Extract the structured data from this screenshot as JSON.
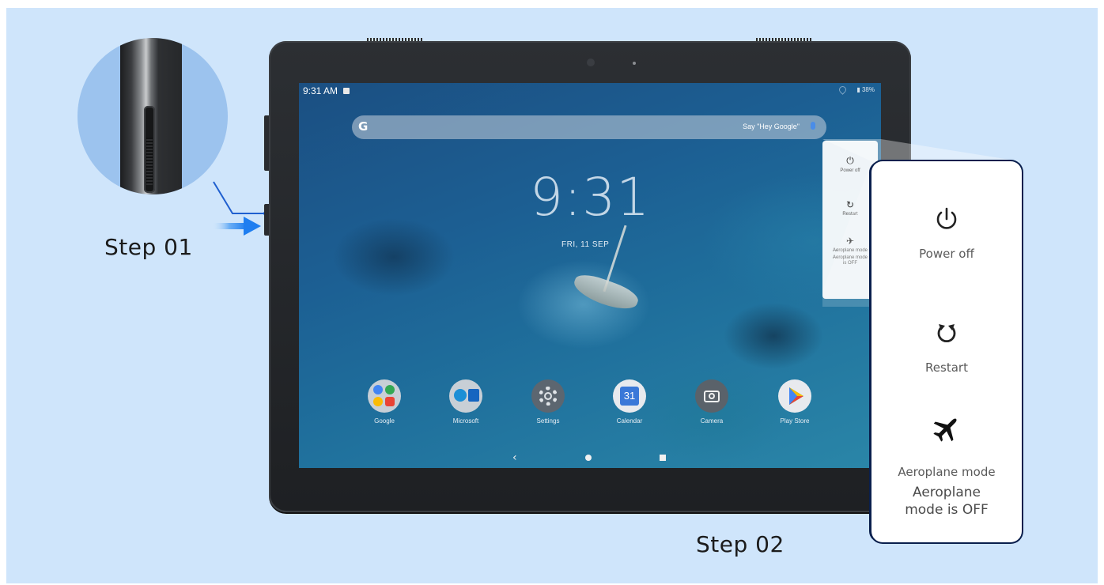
{
  "steps": {
    "step1": "Step 01",
    "step2": "Step 02"
  },
  "status_bar": {
    "time": "9:31 AM",
    "battery": "38%"
  },
  "search": {
    "logo": "G",
    "hint": "Say \"Hey Google\""
  },
  "lock_clock": {
    "time": "9:31",
    "date": "FRI, 11 SEP"
  },
  "dock_apps": [
    {
      "label": "Google",
      "icon": "google-folder-icon"
    },
    {
      "label": "Microsoft",
      "icon": "microsoft-folder-icon"
    },
    {
      "label": "Settings",
      "icon": "settings-gear-icon"
    },
    {
      "label": "Calendar",
      "icon": "calendar-icon",
      "badge": "31"
    },
    {
      "label": "Camera",
      "icon": "camera-icon"
    },
    {
      "label": "Play Store",
      "icon": "play-store-icon"
    }
  ],
  "power_menu_small": {
    "power_off": "Power off",
    "restart": "Restart",
    "aeroplane": "Aeroplane mode",
    "aeroplane_status": "Aeroplane mode is OFF"
  },
  "power_menu_big": {
    "power_off": "Power off",
    "restart": "Restart",
    "aeroplane": "Aeroplane mode",
    "aeroplane_status": "Aeroplane mode is OFF"
  },
  "colors": {
    "background": "#cfe5fb",
    "tablet_frame": "#1e2023",
    "arrow_accent": "#2f86f0",
    "callout_border": "#0a1f4d"
  }
}
